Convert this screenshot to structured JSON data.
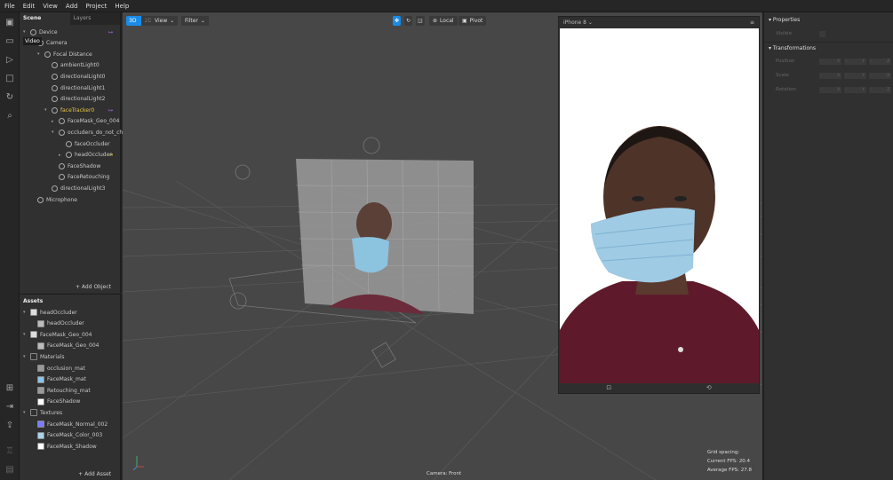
{
  "menu": [
    "File",
    "Edit",
    "View",
    "Add",
    "Project",
    "Help"
  ],
  "tooltip": "Video",
  "scene": {
    "tabs": [
      "Scene",
      "Layers"
    ],
    "items": [
      {
        "label": "Device",
        "depth": 0,
        "arrow": "▾",
        "icon": "phone-icon"
      },
      {
        "label": "Camera",
        "depth": 1,
        "arrow": "▾",
        "icon": "camera-icon"
      },
      {
        "label": "Focal Distance",
        "depth": 2,
        "arrow": "▾",
        "icon": "focal-icon"
      },
      {
        "label": "ambientLight0",
        "depth": 3,
        "arrow": "",
        "icon": "ambient-light-icon"
      },
      {
        "label": "directionalLight0",
        "depth": 3,
        "arrow": "",
        "icon": "directional-light-icon"
      },
      {
        "label": "directionalLight1",
        "depth": 3,
        "arrow": "",
        "icon": "directional-light-icon"
      },
      {
        "label": "directionalLight2",
        "depth": 3,
        "arrow": "",
        "icon": "directional-light-icon"
      },
      {
        "label": "faceTracker0",
        "depth": 3,
        "arrow": "▾",
        "icon": "face-tracker-icon"
      },
      {
        "label": "FaceMask_Geo_004",
        "depth": 4,
        "arrow": "▸",
        "icon": "mesh-icon"
      },
      {
        "label": "occluders_do_not_cha...",
        "depth": 4,
        "arrow": "▾",
        "icon": "null-object-icon"
      },
      {
        "label": "faceOccluder",
        "depth": 5,
        "arrow": "",
        "icon": "face-mesh-icon"
      },
      {
        "label": "headOccluder",
        "depth": 5,
        "arrow": "▸",
        "icon": "mesh-icon"
      },
      {
        "label": "FaceShadow",
        "depth": 4,
        "arrow": "",
        "icon": "face-mesh-icon"
      },
      {
        "label": "FaceRetouching",
        "depth": 4,
        "arrow": "",
        "icon": "face-mesh-icon"
      },
      {
        "label": "directionalLight3",
        "depth": 3,
        "arrow": "",
        "icon": "directional-light-icon"
      },
      {
        "label": "Microphone",
        "depth": 1,
        "arrow": "",
        "icon": "microphone-icon"
      }
    ],
    "add_label": "+ Add Object"
  },
  "assets": {
    "title": "Assets",
    "items": [
      {
        "label": "headOccluder",
        "depth": 0,
        "arrow": "▾",
        "color": "#dddddd"
      },
      {
        "label": "headOccluder",
        "depth": 1,
        "arrow": "",
        "color": "#bbbbbb"
      },
      {
        "label": "FaceMask_Geo_004",
        "depth": 0,
        "arrow": "▾",
        "color": "#dddddd"
      },
      {
        "label": "FaceMask_Geo_004",
        "depth": 1,
        "arrow": "",
        "color": "#bbbbbb"
      },
      {
        "label": "Materials",
        "depth": 0,
        "arrow": "▾",
        "color": "#303030"
      },
      {
        "label": "occlusion_mat",
        "depth": 1,
        "arrow": "",
        "color": "#999999"
      },
      {
        "label": "FaceMask_mat",
        "depth": 1,
        "arrow": "",
        "color": "#8ec4e8"
      },
      {
        "label": "Retouching_mat",
        "depth": 1,
        "arrow": "",
        "color": "#999999"
      },
      {
        "label": "FaceShadow",
        "depth": 1,
        "arrow": "",
        "color": "#ffffff"
      },
      {
        "label": "Textures",
        "depth": 0,
        "arrow": "▾",
        "color": "#303030"
      },
      {
        "label": "FaceMask_Normal_002",
        "depth": 1,
        "arrow": "",
        "color": "#7b7bff"
      },
      {
        "label": "FaceMask_Color_003",
        "depth": 1,
        "arrow": "",
        "color": "#a9d3ee"
      },
      {
        "label": "FaceMask_Shadow",
        "depth": 1,
        "arrow": "",
        "color": "#ffffff"
      }
    ],
    "add_label": "+ Add Asset"
  },
  "viewport": {
    "mode_3d": "3D",
    "mode_2d": "2D",
    "view": "View",
    "filter": "Filter",
    "local": "Local",
    "pivot": "Pivot",
    "camera_label": "Camera: Front",
    "stats": {
      "grid": "Grid spacing:",
      "current_label": "Current FPS:",
      "current": "20.4",
      "average_label": "Average FPS:",
      "average": "27.8"
    }
  },
  "simulator": {
    "device": "iPhone 8"
  },
  "properties": {
    "title": "Properties",
    "visible": "Visible",
    "transformations": "Transformations",
    "rows": [
      "Position",
      "Scale",
      "Rotation"
    ],
    "axes": [
      "X",
      "Y",
      "Z"
    ],
    "placeholder": "-"
  },
  "colors": {
    "accent": "#1a8ce8",
    "selected": "#e8c44a",
    "link": "#b06cf0"
  }
}
